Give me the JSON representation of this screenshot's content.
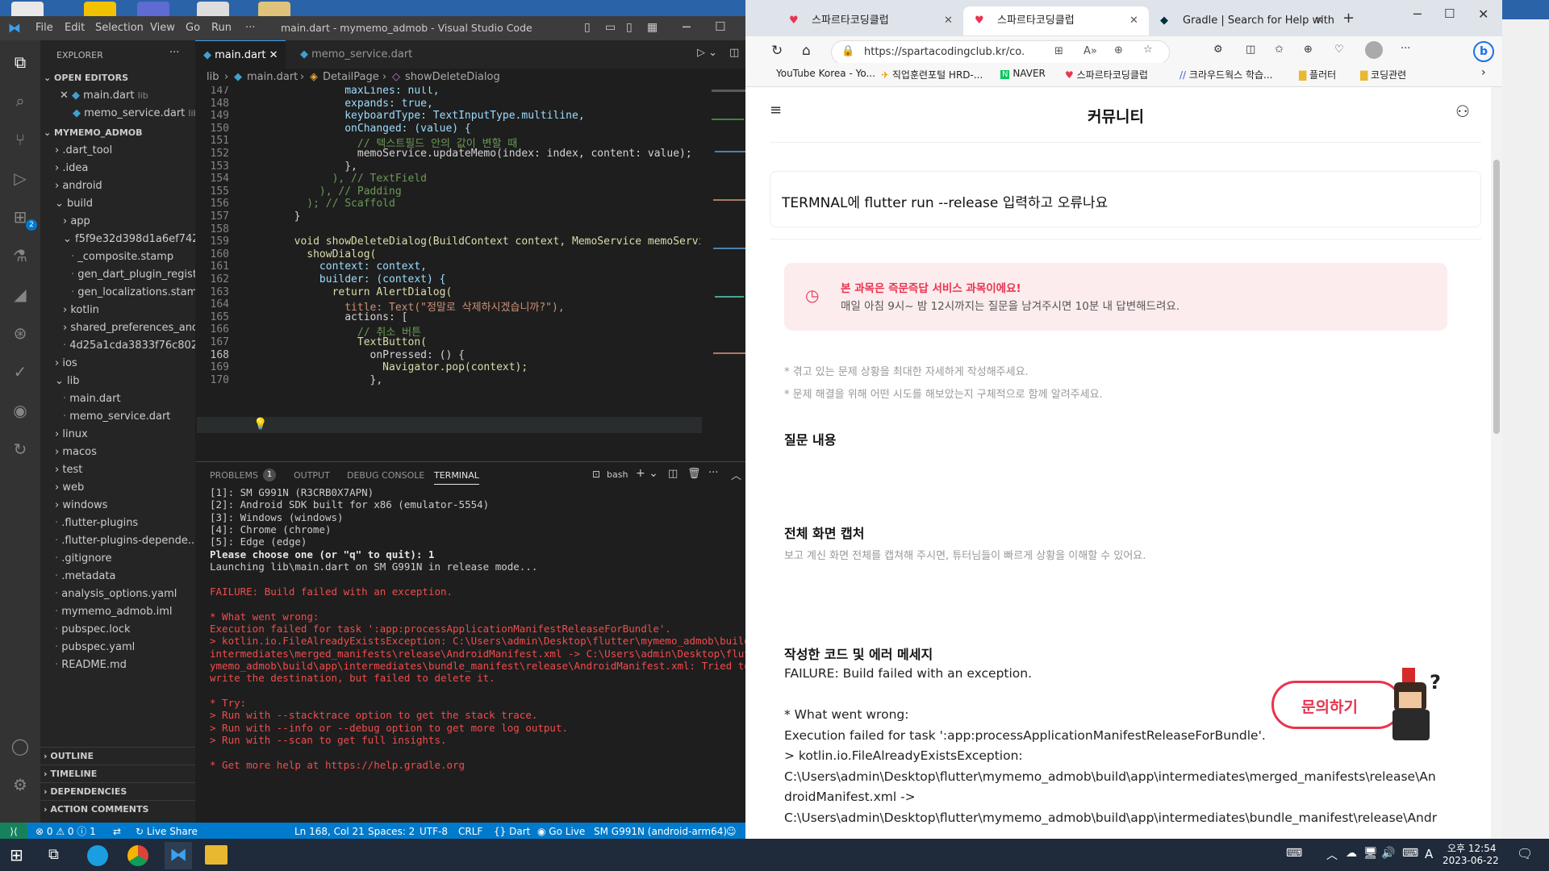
{
  "vscode": {
    "title": "main.dart - mymemo_admob - Visual Studio Code",
    "menu": [
      "File",
      "Edit",
      "Selection",
      "View",
      "Go",
      "Run",
      "···"
    ],
    "explorer_title": "EXPLORER",
    "open_editors_title": "OPEN EDITORS",
    "open_editors": [
      {
        "name": "main.dart",
        "hint": "lib"
      },
      {
        "name": "memo_service.dart",
        "hint": "lib"
      }
    ],
    "project_title": "MYMEMO_ADMOB",
    "tree": [
      ".dart_tool",
      ".idea",
      "android",
      "build",
      "app",
      "f5f9e32d398d1a6ef742...",
      "_composite.stamp",
      "gen_dart_plugin_regist...",
      "gen_localizations.stamp",
      "kotlin",
      "shared_preferences_and...",
      "4d25a1cda3833f76c802...",
      "ios",
      "lib",
      "main.dart",
      "memo_service.dart",
      "linux",
      "macos",
      "test",
      "web",
      "windows",
      ".flutter-plugins",
      ".flutter-plugins-depende...",
      ".gitignore",
      ".metadata",
      "analysis_options.yaml",
      "mymemo_admob.iml",
      "pubspec.lock",
      "pubspec.yaml",
      "README.md"
    ],
    "sections": [
      "OUTLINE",
      "TIMELINE",
      "DEPENDENCIES",
      "ACTION COMMENTS"
    ],
    "badge": "2",
    "tabs": [
      "main.dart",
      "memo_service.dart"
    ],
    "breadcrumb": [
      "lib",
      "main.dart",
      "DetailPage",
      "showDeleteDialog"
    ],
    "code": [
      {
        "n": "147",
        "t": "                maxLines: null,"
      },
      {
        "n": "148",
        "t": "                expands: true,"
      },
      {
        "n": "149",
        "t": "                keyboardType: TextInputType.multiline,"
      },
      {
        "n": "150",
        "t": "                onChanged: (value) {"
      },
      {
        "n": "151",
        "t": "                  // 텍스트필드 안의 값이 변할 때"
      },
      {
        "n": "152",
        "t": "                  memoService.updateMemo(index: index, content: value);"
      },
      {
        "n": "153",
        "t": "                },"
      },
      {
        "n": "154",
        "t": "              ), // TextField"
      },
      {
        "n": "155",
        "t": "            ), // Padding"
      },
      {
        "n": "156",
        "t": "          ); // Scaffold"
      },
      {
        "n": "157",
        "t": "        }"
      },
      {
        "n": "158",
        "t": ""
      },
      {
        "n": "159",
        "t": "        void showDeleteDialog(BuildContext context, MemoService memoService) {"
      },
      {
        "n": "160",
        "t": "          showDialog("
      },
      {
        "n": "161",
        "t": "            context: context,"
      },
      {
        "n": "162",
        "t": "            builder: (context) {"
      },
      {
        "n": "163",
        "t": "              return AlertDialog("
      },
      {
        "n": "164",
        "t": "                title: Text(\"정말로 삭제하시겠습니까?\"),"
      },
      {
        "n": "165",
        "t": "                actions: ["
      },
      {
        "n": "166",
        "t": "                  // 취소 버튼"
      },
      {
        "n": "167",
        "t": "                  TextButton("
      },
      {
        "n": "168",
        "t": "                    onPressed: () {"
      },
      {
        "n": "169",
        "t": "                      Navigator.pop(context);"
      },
      {
        "n": "170",
        "t": "                    },"
      }
    ],
    "panel_tabs": [
      "PROBLEMS",
      "OUTPUT",
      "DEBUG CONSOLE",
      "TERMINAL"
    ],
    "problems_count": "1",
    "shell": "bash",
    "terminal": [
      {
        "t": "[1]: SM G991N (R3CRB0X7APN)",
        "c": "n"
      },
      {
        "t": "[2]: Android SDK built for x86 (emulator-5554)",
        "c": "n"
      },
      {
        "t": "[3]: Windows (windows)",
        "c": "n"
      },
      {
        "t": "[4]: Chrome (chrome)",
        "c": "n"
      },
      {
        "t": "[5]: Edge (edge)",
        "c": "n"
      },
      {
        "t": "Please choose one (or \"q\" to quit): 1",
        "c": "b"
      },
      {
        "t": "Launching lib\\main.dart on SM G991N in release mode...",
        "c": "n"
      },
      {
        "t": "",
        "c": "n"
      },
      {
        "t": "FAILURE: Build failed with an exception.",
        "c": "e"
      },
      {
        "t": "",
        "c": "n"
      },
      {
        "t": "* What went wrong:",
        "c": "e"
      },
      {
        "t": "Execution failed for task ':app:processApplicationManifestReleaseForBundle'.",
        "c": "e"
      },
      {
        "t": "> kotlin.io.FileAlreadyExistsException: C:\\Users\\admin\\Desktop\\flutter\\mymemo_admob\\build\\app\\",
        "c": "e"
      },
      {
        "t": "intermediates\\merged_manifests\\release\\AndroidManifest.xml -> C:\\Users\\admin\\Desktop\\flutter\\m",
        "c": "e"
      },
      {
        "t": "ymemo_admob\\build\\app\\intermediates\\bundle_manifest\\release\\AndroidManifest.xml: Tried to over",
        "c": "e"
      },
      {
        "t": "write the destination, but failed to delete it.",
        "c": "e"
      },
      {
        "t": "",
        "c": "n"
      },
      {
        "t": "* Try:",
        "c": "e"
      },
      {
        "t": "> Run with --stacktrace option to get the stack trace.",
        "c": "e"
      },
      {
        "t": "> Run with --info or --debug option to get more log output.",
        "c": "e"
      },
      {
        "t": "> Run with --scan to get full insights.",
        "c": "e"
      },
      {
        "t": "",
        "c": "n"
      },
      {
        "t": "* Get more help at https://help.gradle.org",
        "c": "e"
      }
    ],
    "status": {
      "problems": "⊗ 0 ⚠ 0 ⓘ 1",
      "live_share": "Live Share",
      "position": "Ln 168, Col 21",
      "spaces": "Spaces: 2",
      "encoding": "UTF-8",
      "eol": "CRLF",
      "language": "Dart",
      "golive": "Go Live",
      "device": "SM G991N (android-arm64)"
    },
    "colors": {
      "title": "#3c3c3c",
      "activity": "#333333",
      "sidebar": "#252526",
      "editor": "#1e1e1e",
      "status": "#007acc",
      "error": "#f14c4c"
    }
  },
  "browser": {
    "tabs": [
      "스파르타코딩클럽",
      "스파르타코딩클럽",
      "Gradle | Search for Help with G"
    ],
    "url": "https://spartacodingclub.kr/co...",
    "favorites": [
      "YouTube Korea - Yo...",
      "직업훈련포털 HRD-...",
      "NAVER",
      "스파르타코딩클럽",
      "크라우드웍스 학습...",
      "플러터",
      "코딩관련"
    ],
    "page_title": "커뮤니티",
    "question_title": "TERMNAL에 flutter run --release 입력하고 오류나요",
    "notice_title": "본 과목은 즉문즉답 서비스 과목이에요!",
    "notice_body": "매일 아침 9시~ 밤 12시까지는 질문을 남겨주시면 10분 내 답변해드려요.",
    "hints": [
      "* 겪고 있는 문제 상황을 최대한 자세하게 작성해주세요.",
      "* 문제 해결을 위해 어떤 시도를 해보았는지 구체적으로 함께 알려주세요."
    ],
    "section_question": "질문 내용",
    "section_capture": "전체 화면 캡처",
    "capture_hint": "보고 계신 화면 전체를 캡쳐해 주시면, 튜터님들이 빠르게 상황을 이해할 수 있어요.",
    "section_code": "작성한 코드 및 에러 메세지",
    "code_lines": [
      "FAILURE: Build failed with an exception.",
      "",
      "* What went wrong:",
      "Execution failed for task ':app:processApplicationManifestReleaseForBundle'.",
      "> kotlin.io.FileAlreadyExistsException:",
      "C:\\Users\\admin\\Desktop\\flutter\\mymemo_admob\\build\\app\\intermediates\\merged_manifests\\release\\An",
      "droidManifest.xml ->",
      "C:\\Users\\admin\\Desktop\\flutter\\mymemo_admob\\build\\app\\intermediates\\bundle_manifest\\release\\Andr"
    ],
    "ask_button": "문의하기",
    "colors": {
      "accent": "#e8344e",
      "notice_bg": "#fdecee"
    }
  },
  "taskbar": {
    "time": "오후 12:54",
    "date": "2023-06-22",
    "ime": "A"
  }
}
